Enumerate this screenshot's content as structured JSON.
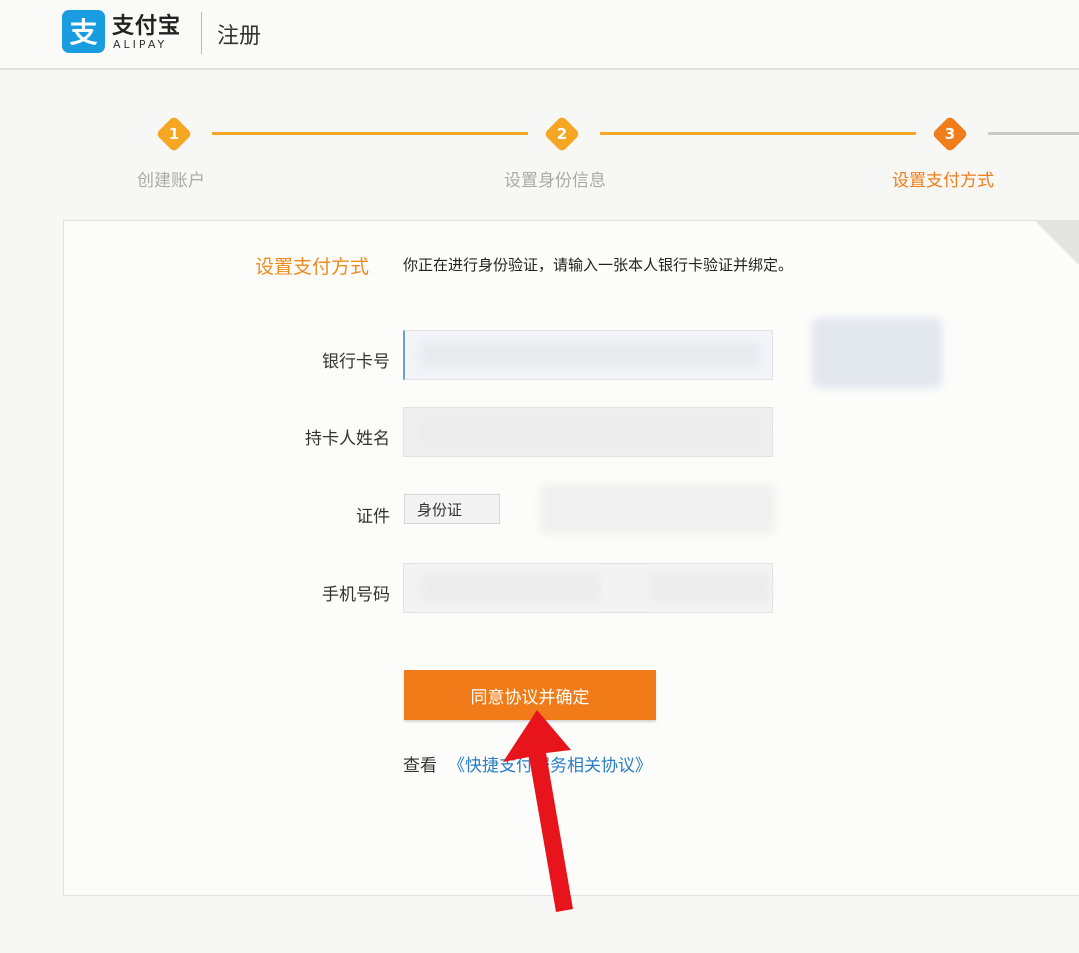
{
  "header": {
    "logo_cn": "支付宝",
    "logo_en": "ALIPAY",
    "page_title": "注册",
    "brand_color": "#1a9ce1"
  },
  "steps": [
    {
      "number": "1",
      "label": "创建账户",
      "state": "done"
    },
    {
      "number": "2",
      "label": "设置身份信息",
      "state": "done"
    },
    {
      "number": "3",
      "label": "设置支付方式",
      "state": "active"
    }
  ],
  "form": {
    "section_title": "设置支付方式",
    "intro": "你正在进行身份验证，请输入一张本人银行卡验证并绑定。",
    "fields": {
      "card_number": {
        "label": "银行卡号",
        "value": ""
      },
      "holder_name": {
        "label": "持卡人姓名",
        "value": ""
      },
      "id_type": {
        "label": "证件",
        "selected": "身份证"
      },
      "phone": {
        "label": "手机号码",
        "value": ""
      }
    },
    "confirm_button": "同意协议并确定",
    "view_prefix": "查看",
    "agreement_link": "《快捷支付服务相关协议》"
  },
  "colors": {
    "accent_orange": "#f07b18",
    "step_orange": "#f5a623",
    "link_blue": "#2a7ec6"
  }
}
